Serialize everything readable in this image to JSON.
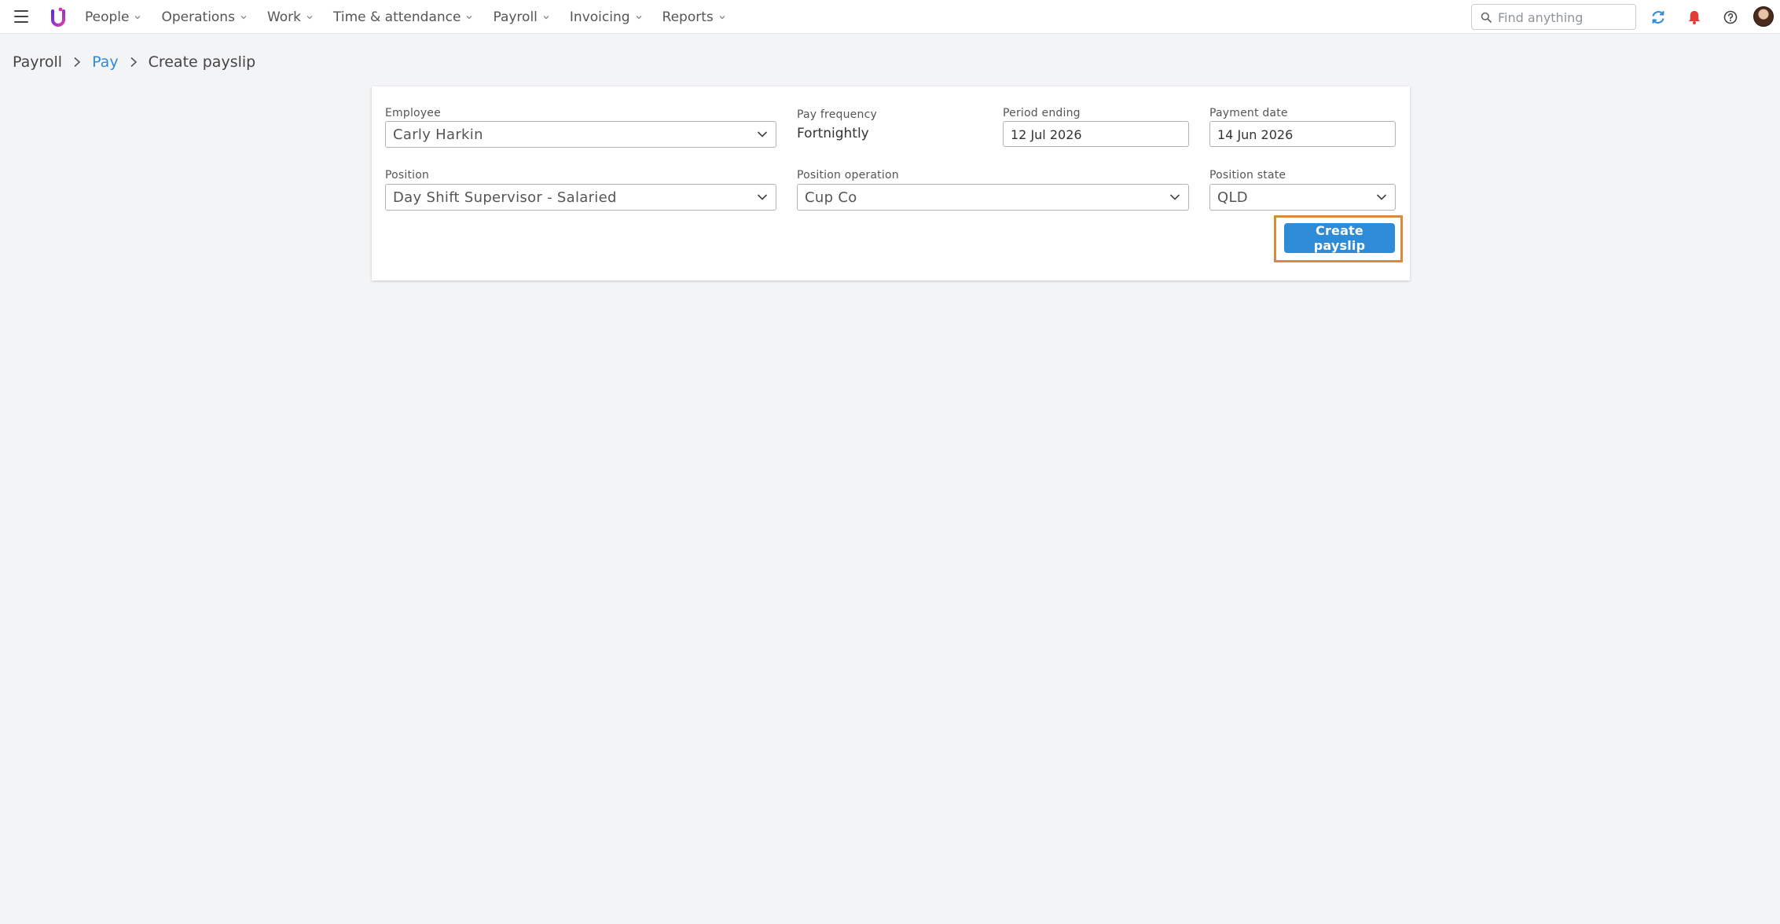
{
  "nav": {
    "items": [
      {
        "label": "People"
      },
      {
        "label": "Operations"
      },
      {
        "label": "Work"
      },
      {
        "label": "Time & attendance"
      },
      {
        "label": "Payroll"
      },
      {
        "label": "Invoicing"
      },
      {
        "label": "Reports"
      }
    ]
  },
  "search": {
    "placeholder": "Find anything"
  },
  "icons": {
    "menu": "hamburger-menu-icon",
    "logo": "brand-logo",
    "search": "search-icon",
    "sync": "sync-icon",
    "notifications": "bell-icon",
    "help": "help-icon",
    "avatar": "user-avatar"
  },
  "colors": {
    "accent": "#2d8bd8",
    "notification": "#e53935",
    "highlight": "#d98a3d",
    "logo_start": "#5b2ee0",
    "logo_end": "#d63ca8"
  },
  "breadcrumb": {
    "items": [
      "Payroll",
      "Pay"
    ],
    "current": "Create payslip"
  },
  "form": {
    "employee": {
      "label": "Employee",
      "value": "Carly Harkin"
    },
    "pay_frequency": {
      "label": "Pay frequency",
      "value": "Fortnightly"
    },
    "period_ending": {
      "label": "Period ending",
      "value": "12 Jul 2026"
    },
    "payment_date": {
      "label": "Payment date",
      "value": "14 Jun 2026"
    },
    "position": {
      "label": "Position",
      "value": "Day Shift Supervisor - Salaried"
    },
    "position_operation": {
      "label": "Position operation",
      "value": "Cup Co"
    },
    "position_state": {
      "label": "Position state",
      "value": "QLD"
    },
    "submit_label": "Create payslip"
  }
}
